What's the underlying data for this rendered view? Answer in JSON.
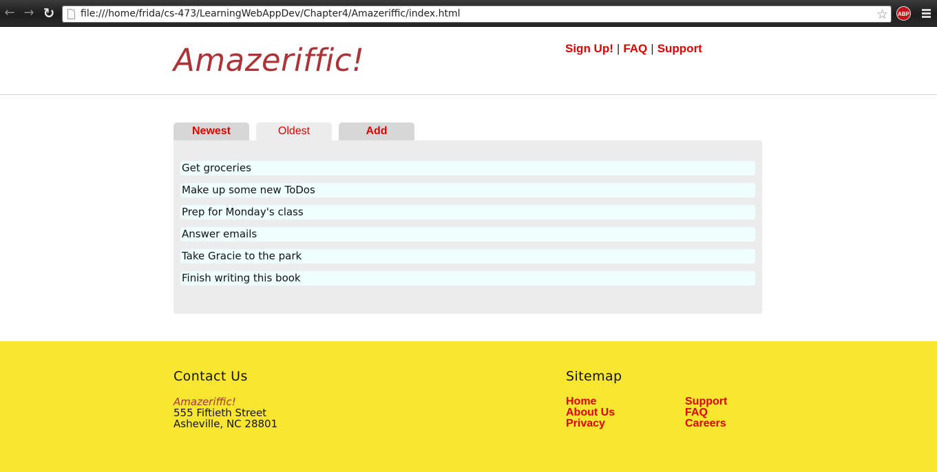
{
  "browser": {
    "url": "file:///home/frida/cs-473/LearningWebAppDev/Chapter4/Amazeriffic/index.html",
    "back_icon": "back-arrow-icon",
    "forward_icon": "forward-arrow-icon",
    "reload_icon": "reload-icon",
    "bookmark_icon": "star-icon",
    "extension_label": "ABP",
    "menu_icon": "hamburger-menu-icon"
  },
  "header": {
    "logo": "Amazeriffic!",
    "nav": [
      {
        "label": "Sign Up!"
      },
      {
        "label": "FAQ"
      },
      {
        "label": "Support"
      }
    ],
    "separator": "|"
  },
  "tabs": [
    {
      "label": "Newest",
      "active": false
    },
    {
      "label": "Oldest",
      "active": true
    },
    {
      "label": "Add",
      "active": false
    }
  ],
  "todos": [
    "Get groceries",
    "Make up some new ToDos",
    "Prep for Monday's class",
    "Answer emails",
    "Take Gracie to the park",
    "Finish writing this book"
  ],
  "footer": {
    "contact": {
      "heading": "Contact Us",
      "brand": "Amazeriffic!",
      "street": "555 Fiftieth Street",
      "city": "Asheville, NC 28801"
    },
    "sitemap": {
      "heading": "Sitemap",
      "col1": [
        "Home",
        "About Us",
        "Privacy"
      ],
      "col2": [
        "Support",
        "FAQ",
        "Careers"
      ]
    }
  },
  "colors": {
    "brand": "#ab3438",
    "link": "#dd0000",
    "footer_bg": "#f8e631",
    "panel_bg": "#ececec",
    "todo_bg": "#eefffe"
  }
}
